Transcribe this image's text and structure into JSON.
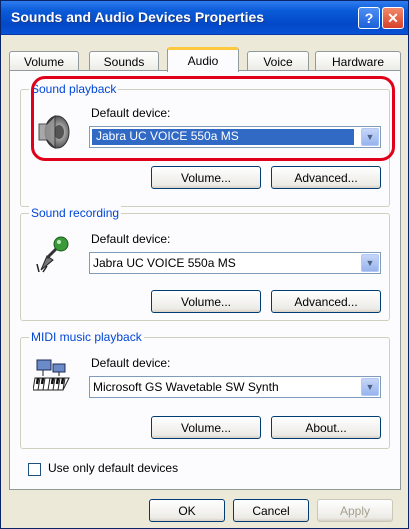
{
  "window": {
    "title": "Sounds and Audio Devices Properties",
    "help_glyph": "?",
    "close_glyph": "✕"
  },
  "tabs": [
    {
      "label": "Volume"
    },
    {
      "label": "Sounds"
    },
    {
      "label": "Audio",
      "active": true
    },
    {
      "label": "Voice"
    },
    {
      "label": "Hardware"
    }
  ],
  "groups": {
    "playback": {
      "title": "Sound playback",
      "device_label": "Default device:",
      "device_value": "Jabra UC VOICE 550a MS",
      "volume_button": "Volume...",
      "advanced_button": "Advanced...",
      "icon": "speaker-icon"
    },
    "recording": {
      "title": "Sound recording",
      "device_label": "Default device:",
      "device_value": "Jabra UC VOICE 550a MS",
      "volume_button": "Volume...",
      "advanced_button": "Advanced...",
      "icon": "microphone-icon"
    },
    "midi": {
      "title": "MIDI music playback",
      "device_label": "Default device:",
      "device_value": "Microsoft GS Wavetable SW Synth",
      "volume_button": "Volume...",
      "about_button": "About...",
      "icon": "midi-keyboard-icon"
    }
  },
  "options": {
    "use_default_only_label": "Use only default devices",
    "use_default_only_checked": false
  },
  "footer": {
    "ok": "OK",
    "cancel": "Cancel",
    "apply": "Apply"
  },
  "colors": {
    "titlebar": "#0a53d6",
    "group_title": "#0046d5",
    "selection": "#316ac5",
    "highlight_ring": "#e1001a"
  }
}
